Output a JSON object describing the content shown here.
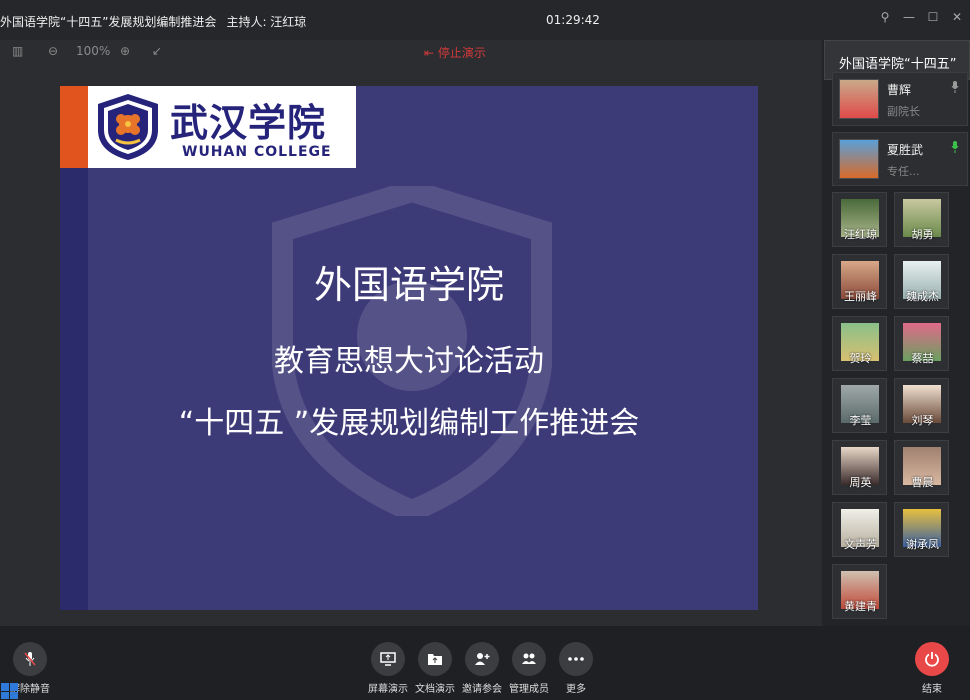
{
  "window": {
    "title": "外国语学院“十四五”发展规划编制推进会",
    "host": "主持人: 汪红琼",
    "time": "01:29:42"
  },
  "toolbar": {
    "zoom": "100%",
    "stop_label": "停止演示"
  },
  "slide": {
    "logo_cn": "武汉学院",
    "logo_en": "WUHAN COLLEGE",
    "line1": "外国语学院",
    "line2": "教育思想大讨论活动",
    "line3": "“十四五 ”发展规划编制工作推进会"
  },
  "panel": {
    "tooltip": "外国语学院“十四五”",
    "featured": [
      {
        "name": "曹辉",
        "role": "副院长",
        "mic_color": "#9a9a9a"
      },
      {
        "name": "夏胜武",
        "role": "专任...",
        "mic_color": "#3bc24a"
      }
    ],
    "tiles": [
      {
        "name": "汪红琼"
      },
      {
        "name": "胡勇"
      },
      {
        "name": "王丽峰"
      },
      {
        "name": "魏成杰"
      },
      {
        "name": "贺玲"
      },
      {
        "name": "蔡喆"
      },
      {
        "name": "李莹"
      },
      {
        "name": "刘琴"
      },
      {
        "name": "周英"
      },
      {
        "name": "曹晨"
      },
      {
        "name": "文声芳"
      },
      {
        "name": "谢承凤"
      },
      {
        "name": "黄建青"
      }
    ]
  },
  "bottom": {
    "mute_label": "解除静音",
    "buttons": [
      {
        "label": "屏幕演示",
        "icon": "screen-share-icon"
      },
      {
        "label": "文档演示",
        "icon": "document-share-icon"
      },
      {
        "label": "邀请参会",
        "icon": "invite-icon"
      },
      {
        "label": "管理成员",
        "icon": "members-icon"
      },
      {
        "label": "更多",
        "icon": "more-icon"
      }
    ],
    "end_label": "结束"
  }
}
